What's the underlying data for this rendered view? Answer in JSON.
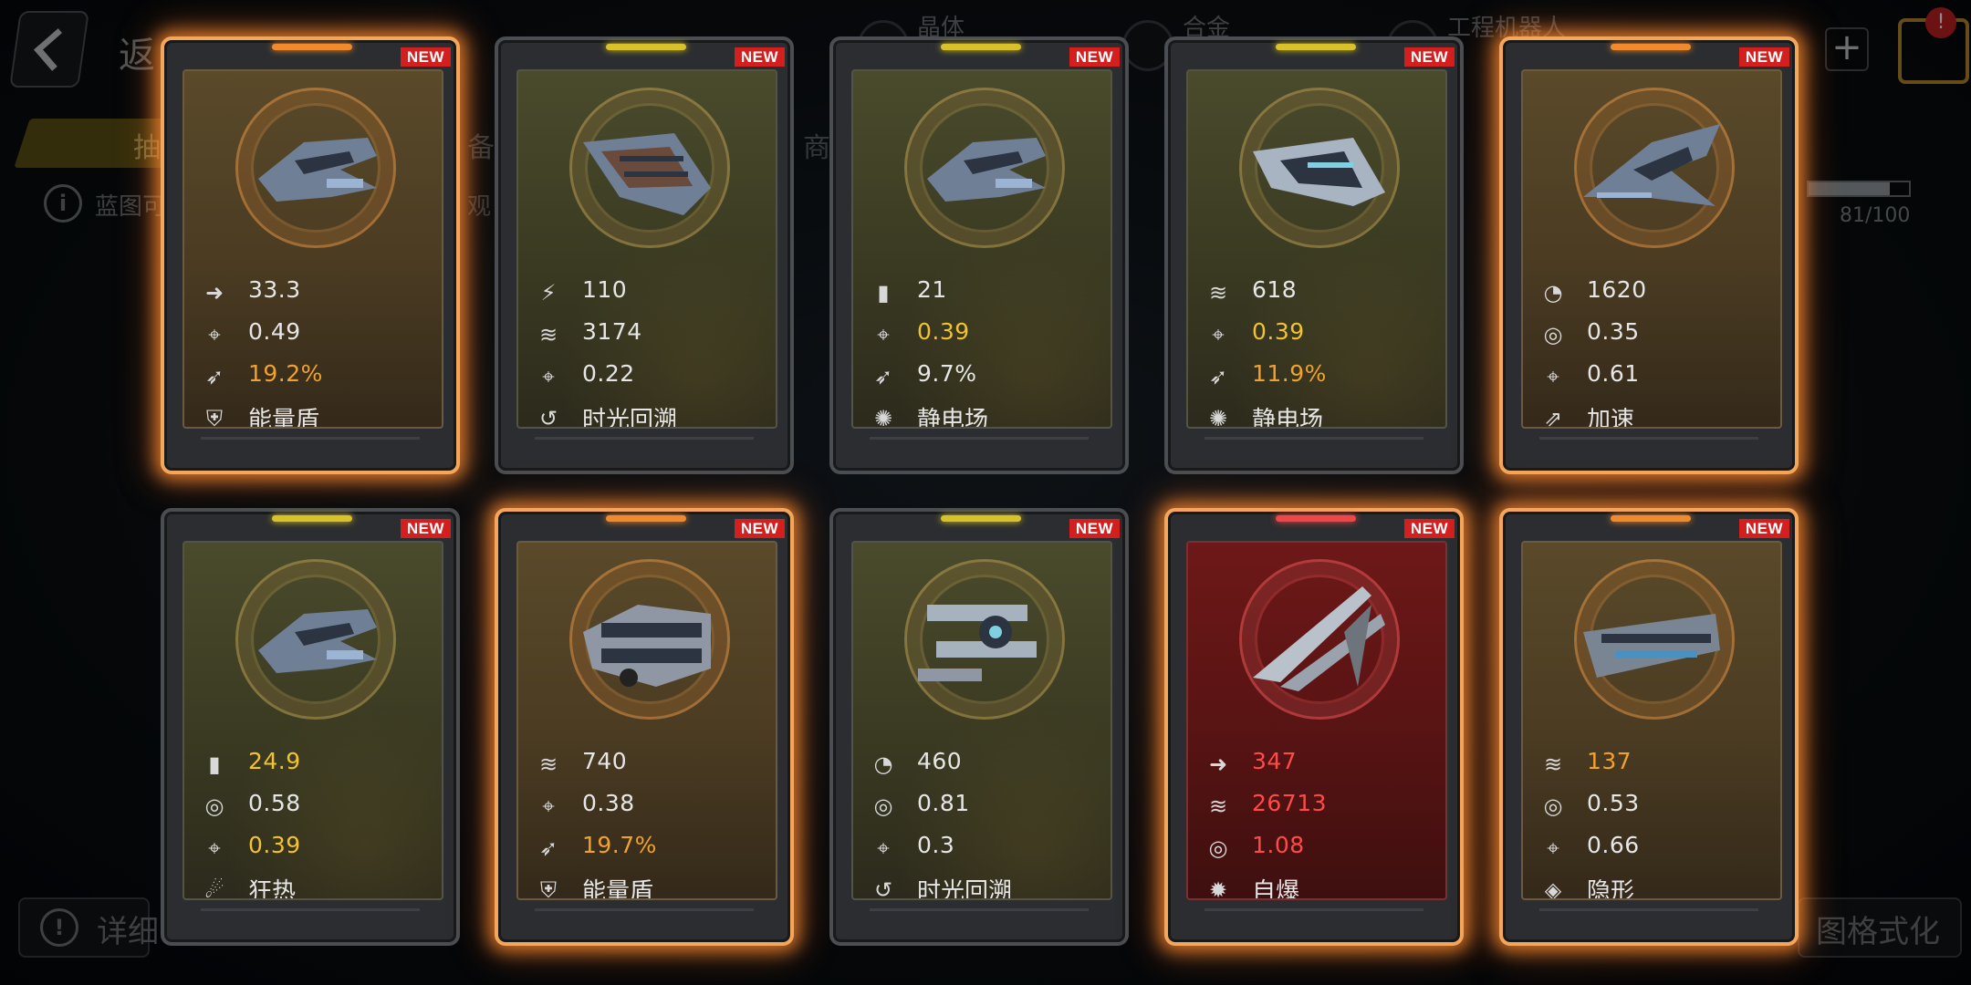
{
  "background": {
    "back_label": "返",
    "top_tabs": [
      "晶体",
      "合金",
      "工程机器人"
    ],
    "yellow_tab_label": "抽",
    "tab2_label": "备",
    "tab3_label": "商",
    "blueprint_label": "蓝图可",
    "blueprint_suffix": "观",
    "progress": {
      "value": 81,
      "max": 100,
      "text": "81/100"
    },
    "detail_label": "详细",
    "format_label": "图格式化",
    "cart_badge": "!",
    "plus_label": "+"
  },
  "new_label": "NEW",
  "colors": {
    "glow": "#f4a65a",
    "orange_text": "#f0a22e",
    "yellow_text": "#f1c232",
    "red_text": "#ff4a4a",
    "rarity_yellow": "#d9c12a",
    "rarity_orange": "#f08a2c",
    "rarity_red": "#f04646"
  },
  "cards": [
    {
      "glow": true,
      "theme": "gold",
      "rarity": "orange",
      "ship_icon": "fighter-ship-icon",
      "stats": [
        {
          "icon": "speed-arrow-icon",
          "value": "33.3",
          "color": "normal"
        },
        {
          "icon": "crosshair-icon",
          "value": "0.49",
          "color": "normal"
        },
        {
          "icon": "missile-icon",
          "value": "19.2%",
          "color": "orange"
        }
      ],
      "skill": {
        "icon": "shield-icon",
        "name": "能量盾"
      }
    },
    {
      "glow": false,
      "theme": "olive",
      "rarity": "yellow",
      "ship_icon": "frigate-ship-icon",
      "stats": [
        {
          "icon": "bolt-icon",
          "value": "110",
          "color": "normal"
        },
        {
          "icon": "armor-icon",
          "value": "3174",
          "color": "normal"
        },
        {
          "icon": "crosshair-icon",
          "value": "0.22",
          "color": "normal"
        }
      ],
      "skill": {
        "icon": "time-rewind-icon",
        "name": "时光回溯"
      }
    },
    {
      "glow": false,
      "theme": "olive",
      "rarity": "yellow",
      "ship_icon": "fighter-ship-icon",
      "stats": [
        {
          "icon": "ammo-icon",
          "value": "21",
          "color": "normal"
        },
        {
          "icon": "crosshair-icon",
          "value": "0.39",
          "color": "yellow"
        },
        {
          "icon": "missile-icon",
          "value": "9.7%",
          "color": "normal"
        }
      ],
      "skill": {
        "icon": "static-field-icon",
        "name": "静电场"
      }
    },
    {
      "glow": false,
      "theme": "olive",
      "rarity": "yellow",
      "ship_icon": "cruiser-ship-icon",
      "stats": [
        {
          "icon": "armor-icon",
          "value": "618",
          "color": "normal"
        },
        {
          "icon": "crosshair-icon",
          "value": "0.39",
          "color": "yellow"
        },
        {
          "icon": "missile-icon",
          "value": "11.9%",
          "color": "orange"
        }
      ],
      "skill": {
        "icon": "static-field-icon",
        "name": "静电场"
      }
    },
    {
      "glow": true,
      "theme": "gold",
      "rarity": "orange",
      "ship_icon": "interceptor-ship-icon",
      "stats": [
        {
          "icon": "gauge-icon",
          "value": "1620",
          "color": "normal"
        },
        {
          "icon": "reload-icon",
          "value": "0.35",
          "color": "normal"
        },
        {
          "icon": "crosshair-icon",
          "value": "0.61",
          "color": "normal"
        }
      ],
      "skill": {
        "icon": "boost-icon",
        "name": "加速"
      }
    },
    {
      "glow": false,
      "theme": "olive",
      "rarity": "yellow",
      "ship_icon": "fighter-ship-icon",
      "stats": [
        {
          "icon": "ammo-icon",
          "value": "24.9",
          "color": "yellow"
        },
        {
          "icon": "reload-icon",
          "value": "0.58",
          "color": "normal"
        },
        {
          "icon": "crosshair-icon",
          "value": "0.39",
          "color": "yellow"
        }
      ],
      "skill": {
        "icon": "frenzy-icon",
        "name": "狂热"
      }
    },
    {
      "glow": true,
      "theme": "gold",
      "rarity": "orange",
      "ship_icon": "gunship-ship-icon",
      "stats": [
        {
          "icon": "armor-icon",
          "value": "740",
          "color": "normal"
        },
        {
          "icon": "crosshair-icon",
          "value": "0.38",
          "color": "normal"
        },
        {
          "icon": "missile-icon",
          "value": "19.7%",
          "color": "orange"
        }
      ],
      "skill": {
        "icon": "shield-icon",
        "name": "能量盾"
      }
    },
    {
      "glow": false,
      "theme": "olive",
      "rarity": "yellow",
      "ship_icon": "drone-ship-icon",
      "stats": [
        {
          "icon": "gauge-icon",
          "value": "460",
          "color": "normal"
        },
        {
          "icon": "reload-icon",
          "value": "0.81",
          "color": "normal"
        },
        {
          "icon": "crosshair-icon",
          "value": "0.3",
          "color": "normal"
        }
      ],
      "skill": {
        "icon": "time-rewind-icon",
        "name": "时光回溯"
      }
    },
    {
      "glow": true,
      "theme": "red",
      "rarity": "red",
      "ship_icon": "bomber-ship-icon",
      "stats": [
        {
          "icon": "speed-arrow-icon",
          "value": "347",
          "color": "red"
        },
        {
          "icon": "armor-icon",
          "value": "26713",
          "color": "red"
        },
        {
          "icon": "reload-icon",
          "value": "1.08",
          "color": "red"
        }
      ],
      "skill": {
        "icon": "self-destruct-icon",
        "name": "自爆"
      }
    },
    {
      "glow": true,
      "theme": "gold",
      "rarity": "orange",
      "ship_icon": "destroyer-ship-icon",
      "stats": [
        {
          "icon": "armor-icon",
          "value": "137",
          "color": "orange"
        },
        {
          "icon": "reload-icon",
          "value": "0.53",
          "color": "normal"
        },
        {
          "icon": "crosshair-icon",
          "value": "0.66",
          "color": "normal"
        }
      ],
      "skill": {
        "icon": "stealth-icon",
        "name": "隐形"
      }
    }
  ]
}
